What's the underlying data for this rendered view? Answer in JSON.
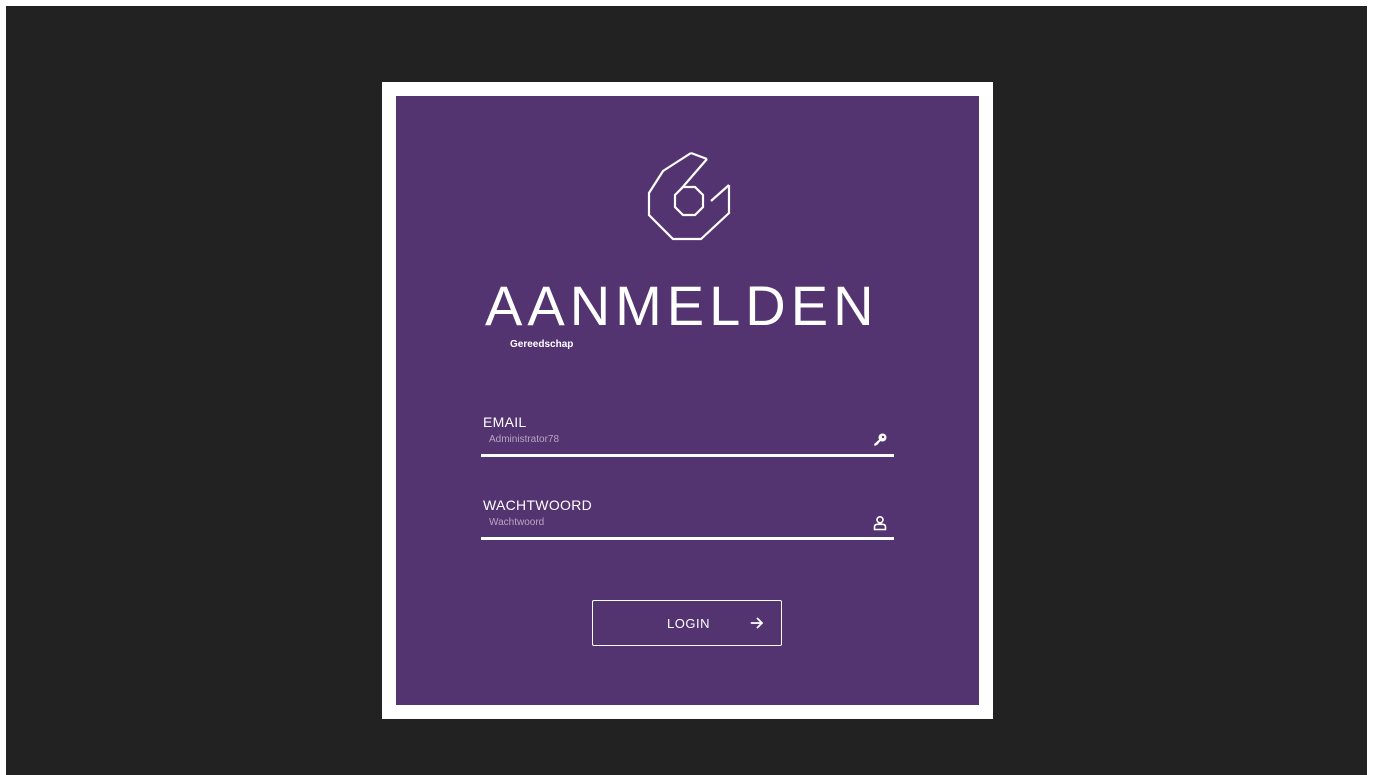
{
  "login": {
    "title": "AANMELDEN",
    "subtitle": "Gereedschap",
    "logo_icon": "hexagon-six-logo-icon",
    "email": {
      "label": "EMAIL",
      "placeholder": "Administrator78",
      "icon": "key-icon"
    },
    "password": {
      "label": "WACHTWOORD",
      "placeholder": "Wachtwoord",
      "icon": "user-icon"
    },
    "button": {
      "label": "LOGIN",
      "icon": "arrow-right-icon"
    }
  },
  "colors": {
    "background": "#222222",
    "frame": "#ffffff",
    "panel": "#543371",
    "text": "#ffffff"
  }
}
